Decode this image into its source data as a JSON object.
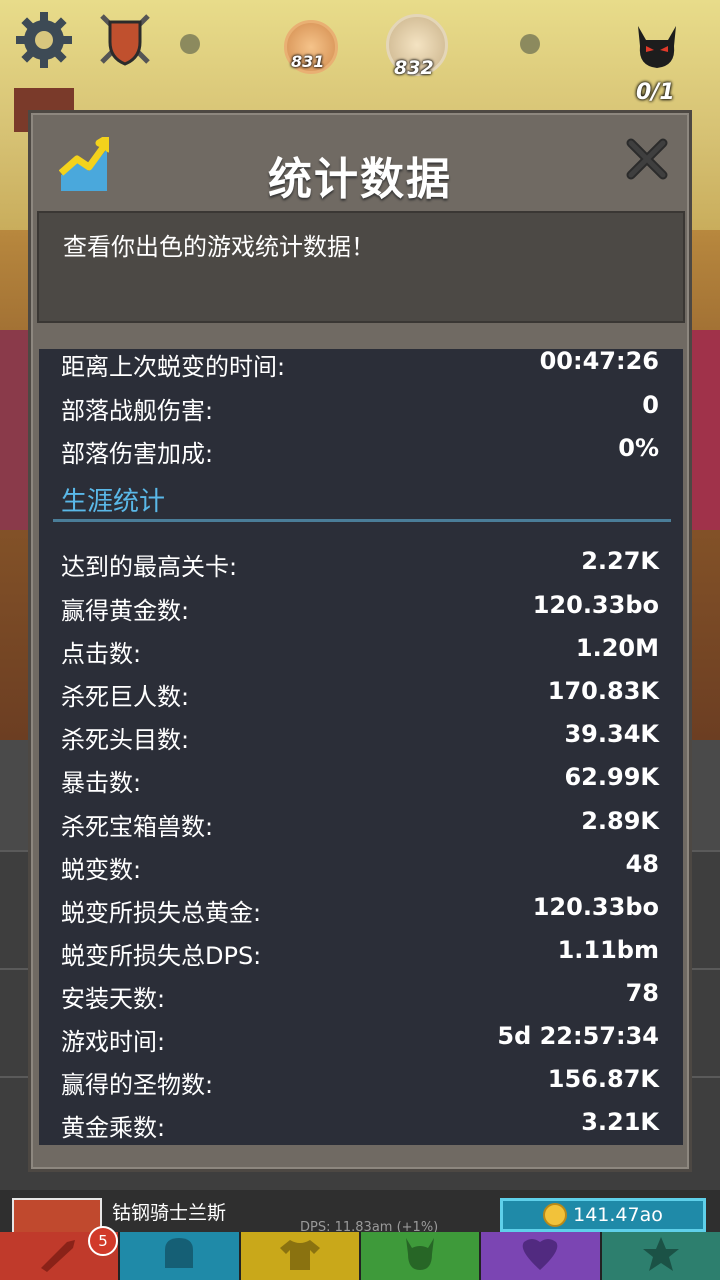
{
  "hud": {
    "stage_prev": "831",
    "stage_current": "832",
    "boss_progress": "0/1"
  },
  "panel": {
    "title": "统计数据",
    "description": "查看你出色的游戏统计数据！",
    "current_stats": [
      {
        "label": "距离上次蜕变的时间:",
        "value": "00:47:26"
      },
      {
        "label": "部落战舰伤害:",
        "value": "0"
      },
      {
        "label": "部落伤害加成:",
        "value": "0%"
      }
    ],
    "career_header": "生涯统计",
    "career_stats": [
      {
        "label": "达到的最高关卡:",
        "value": "2.27K"
      },
      {
        "label": "赢得黄金数:",
        "value": "120.33bo"
      },
      {
        "label": "点击数:",
        "value": "1.20M"
      },
      {
        "label": "杀死巨人数:",
        "value": "170.83K"
      },
      {
        "label": "杀死头目数:",
        "value": "39.34K"
      },
      {
        "label": "暴击数:",
        "value": "62.99K"
      },
      {
        "label": "杀死宝箱兽数:",
        "value": "2.89K"
      },
      {
        "label": "蜕变数:",
        "value": "48"
      },
      {
        "label": "蜕变所损失总黄金:",
        "value": "120.33bo"
      },
      {
        "label": "蜕变所损失总DPS:",
        "value": "1.11bm"
      },
      {
        "label": "安装天数:",
        "value": "78"
      },
      {
        "label": "游戏时间:",
        "value": "5d 22:57:34"
      },
      {
        "label": "赢得的圣物数:",
        "value": "156.87K"
      },
      {
        "label": "黄金乘数:",
        "value": "3.21K"
      }
    ]
  },
  "hero": {
    "name": "钴钢骑士兰斯",
    "dps_text": "DPS: 11.83am (+1%)",
    "cost": "141.47ao"
  },
  "tabs": [
    {
      "icon": "sword-icon",
      "badge": "5",
      "color": "#c03a2b"
    },
    {
      "icon": "helmet-icon",
      "color": "#1f8aa8"
    },
    {
      "icon": "shirt-icon",
      "color": "#c9a81a"
    },
    {
      "icon": "dragon-icon",
      "color": "#3e9a3a"
    },
    {
      "icon": "artifact-icon",
      "color": "#7b45b3"
    },
    {
      "icon": "star-icon",
      "color": "#2d7f6e"
    }
  ]
}
